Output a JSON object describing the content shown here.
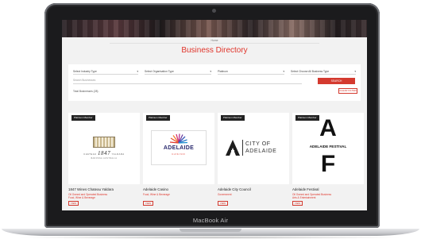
{
  "device": {
    "brand_label": "MacBook Air"
  },
  "page": {
    "breadcrumb": "Home",
    "title": "Business Directory",
    "filters": {
      "industry_type": "Select Industry Type",
      "organisation_type": "Select Organisation Type",
      "membership": "Platinum",
      "business_type": "Select Choose All Business Type",
      "search_placeholder": "Search Businesses",
      "search_button": "SEARCH",
      "found_text": "Total Businesses (28)",
      "clear_button": "CLEAR FILTER"
    },
    "cards": [
      {
        "badge": "Platinum Member",
        "name": "1847 Wines Chateau Yaldara",
        "category": "Oil Owned and Operated Business",
        "category2": "Food, Wine & Beverage",
        "view": "VIEW",
        "logo_text": [
          "CHATEAU",
          "1847",
          "YALDARA",
          "BAROSSA AUSTRALIA"
        ]
      },
      {
        "badge": "Platinum Member",
        "name": "Adelaide Casino",
        "category": "Food, Wine & Beverage",
        "category2": "",
        "view": "VIEW",
        "logo_text": [
          "ADELAIDE",
          "CASINO"
        ]
      },
      {
        "badge": "Platinum Member",
        "name": "Adelaide City Council",
        "category": "Government",
        "category2": "",
        "view": "VIEW",
        "logo_text": [
          "CITY OF",
          "ADELAIDE"
        ]
      },
      {
        "badge": "Platinum Member",
        "name": "Adelaide Festival",
        "category": "Oil Owned and Operated Business",
        "category2": "Arts & Entertainment",
        "view": "VIEW",
        "logo_text": [
          "A",
          "ADELAIDE FESTIVAL",
          "F"
        ]
      }
    ]
  },
  "colors": {
    "accent": "#e0352b",
    "button": "#d43a2f",
    "bezel": "#1b1b1d"
  }
}
